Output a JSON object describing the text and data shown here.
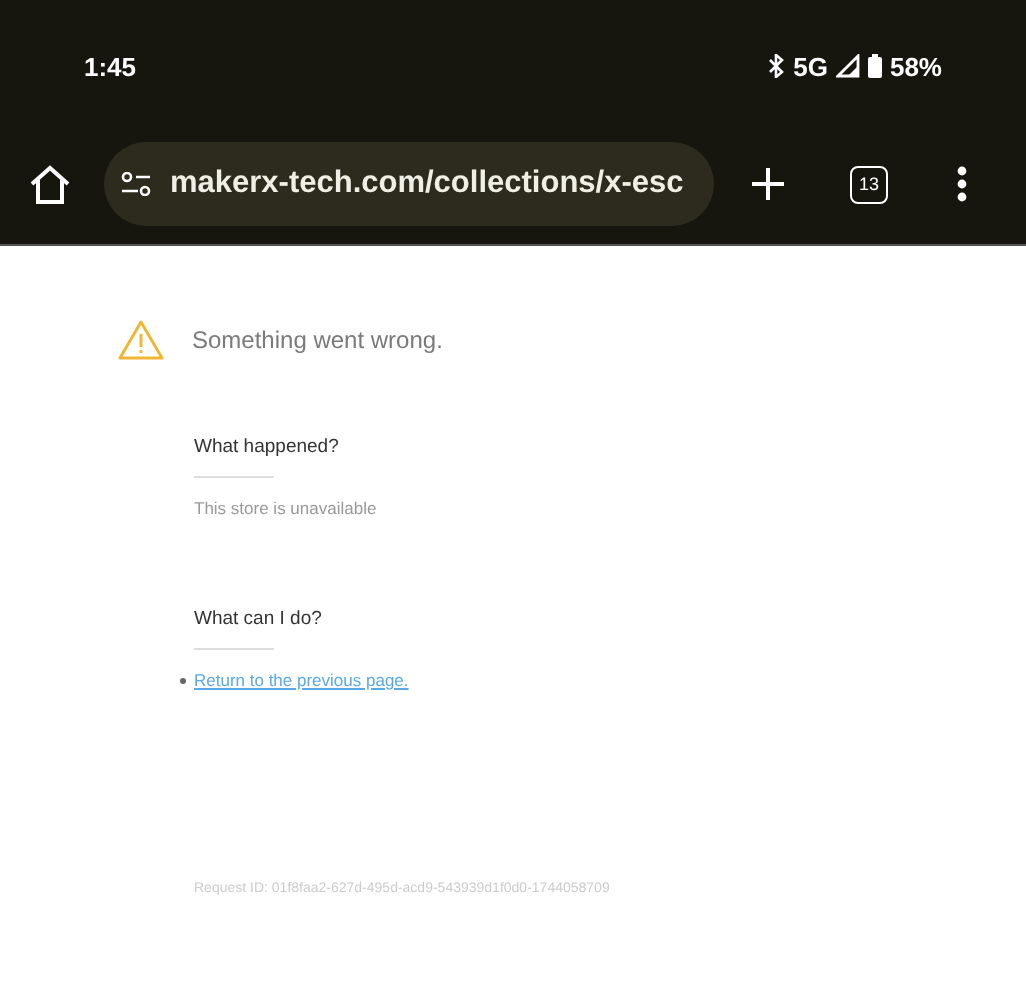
{
  "status_bar": {
    "time": "1:45",
    "network": "5G",
    "battery": "58%"
  },
  "toolbar": {
    "url": "makerx-tech.com/collections/x-esc",
    "tab_count": "13"
  },
  "error": {
    "title": "Something went wrong.",
    "sections": [
      {
        "heading": "What happened?",
        "kind": "text",
        "text": "This store is unavailable"
      },
      {
        "heading": "What can I do?",
        "kind": "link",
        "text": "Return to the previous page."
      }
    ],
    "request_id": "Request ID: 01f8faa2-627d-495d-acd9-543939d1f0d0-1744058709"
  }
}
